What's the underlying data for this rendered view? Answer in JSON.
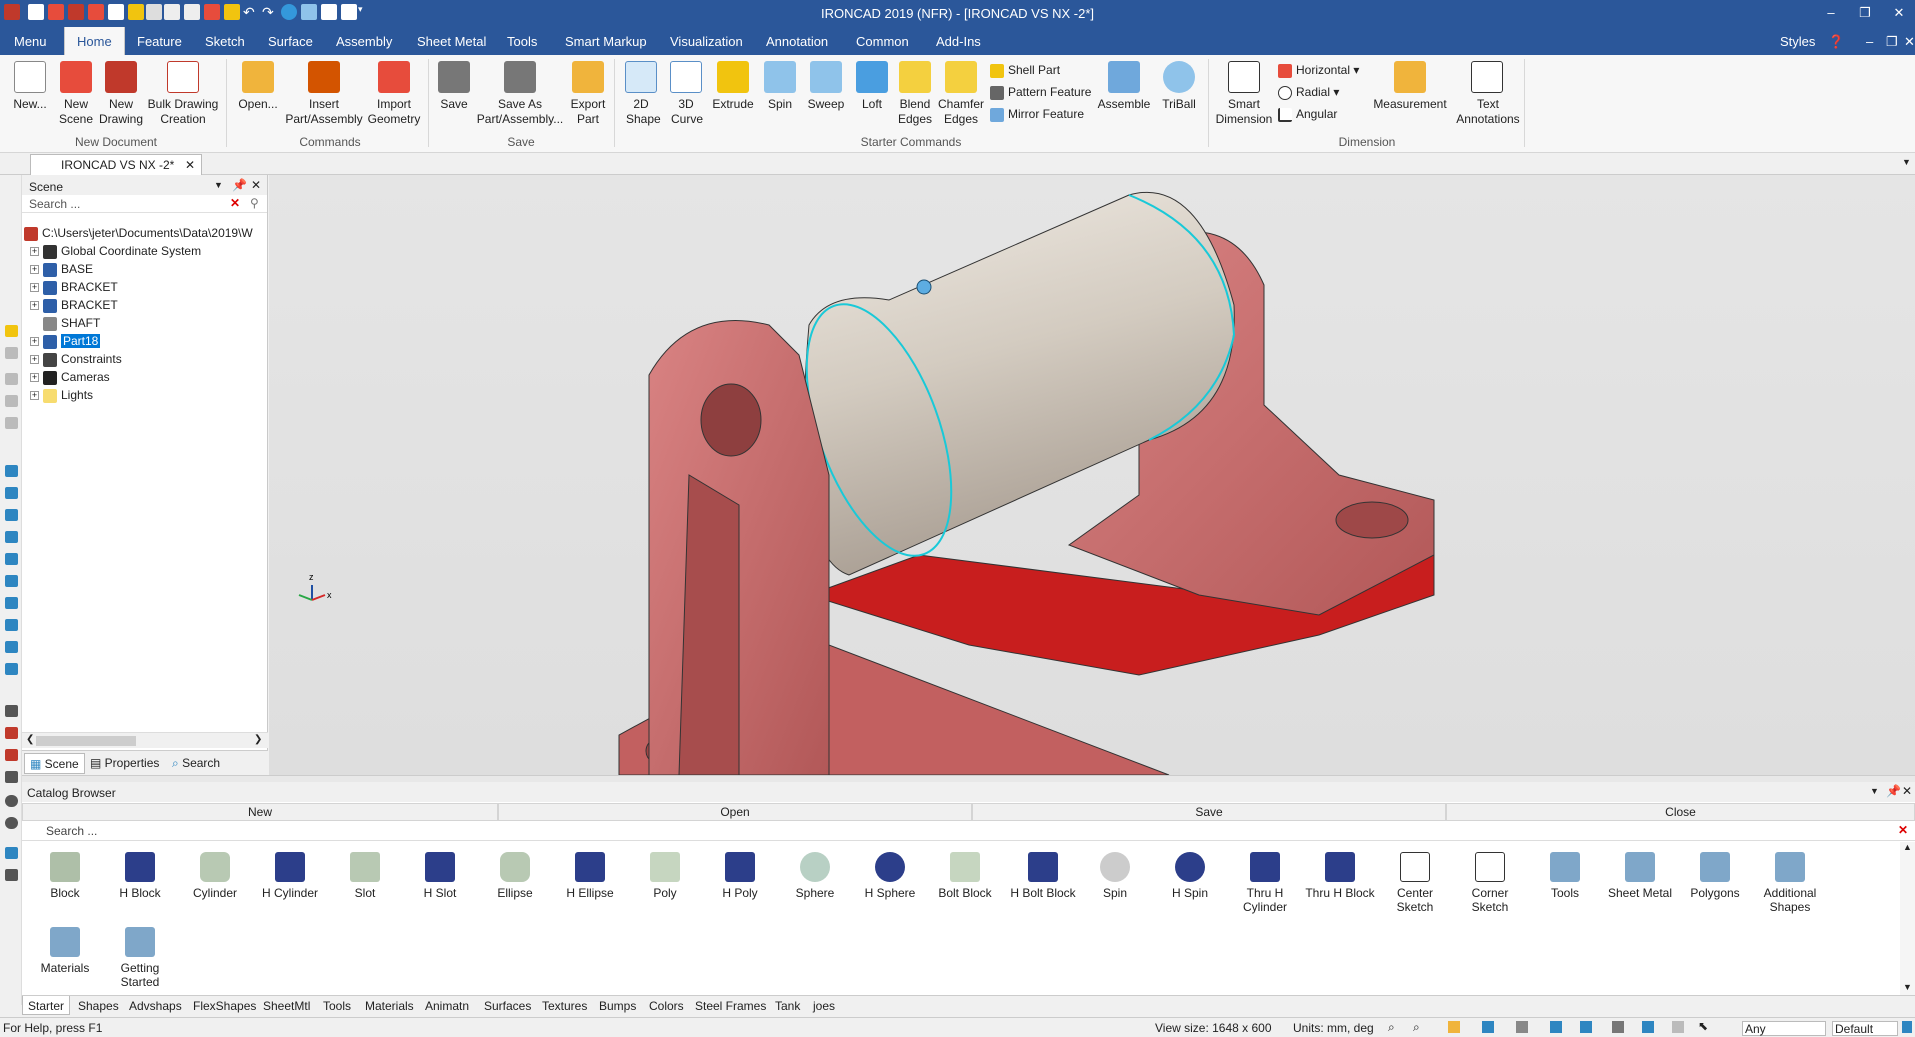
{
  "titlebar": {
    "title": "IRONCAD 2019 (NFR) - [IRONCAD VS NX -2*]"
  },
  "menu": {
    "tabs": [
      "Menu",
      "Home",
      "Feature",
      "Sketch",
      "Surface",
      "Assembly",
      "Sheet Metal",
      "Tools",
      "Smart Markup",
      "Visualization",
      "Annotation",
      "Common",
      "Add-Ins"
    ],
    "styles": "Styles"
  },
  "ribbon": {
    "buttons": [
      "New...",
      "New Scene",
      "New Drawing",
      "Bulk Drawing Creation",
      "Open...",
      "Insert Part/Assembly",
      "Import Geometry",
      "Save",
      "Save As Part/Assembly...",
      "Export Part",
      "2D Shape",
      "3D Curve",
      "Extrude",
      "Spin",
      "Sweep",
      "Loft",
      "Blend Edges",
      "Chamfer Edges",
      "Assemble",
      "TriBall",
      "Smart Dimension",
      "Measurement",
      "Text Annotations"
    ],
    "small": [
      "Shell Part",
      "Pattern Feature",
      "Mirror Feature",
      "Horizontal",
      "Radial",
      "Angular"
    ],
    "groups": [
      "New Document",
      "Commands",
      "Save",
      "Starter Commands",
      "Dimension"
    ]
  },
  "document": {
    "tab": "IRONCAD VS NX -2*"
  },
  "scene": {
    "title": "Scene",
    "search_placeholder": "Search ...",
    "tree": [
      "C:\\Users\\jeter\\Documents\\Data\\2019\\W",
      "Global Coordinate System",
      "BASE",
      "BRACKET",
      "BRACKET",
      "SHAFT",
      "Part18",
      "Constraints",
      "Cameras",
      "Lights"
    ],
    "bottom_tabs": [
      "Scene",
      "Properties",
      "Search"
    ]
  },
  "catalog": {
    "title": "Catalog Browser",
    "bars": [
      "New",
      "Open",
      "Save",
      "Close"
    ],
    "search_placeholder": "Search ...",
    "items": [
      "Block",
      "H Block",
      "Cylinder",
      "H Cylinder",
      "Slot",
      "H Slot",
      "Ellipse",
      "H Ellipse",
      "Poly",
      "H Poly",
      "Sphere",
      "H Sphere",
      "Bolt Block",
      "H Bolt Block",
      "Spin",
      "H Spin",
      "Thru H Cylinder",
      "Thru H Block",
      "Center Sketch",
      "Corner Sketch",
      "Tools",
      "Sheet Metal",
      "Polygons",
      "Additional Shapes",
      "Materials",
      "Getting Started"
    ],
    "tabs": [
      "Starter",
      "Shapes",
      "Advshaps",
      "FlexShapes",
      "SheetMtl",
      "Tools",
      "Materials",
      "Animatn",
      "Surfaces",
      "Textures",
      "Bumps",
      "Colors",
      "Steel Frames",
      "Tank",
      "joes"
    ]
  },
  "status": {
    "help": "For Help, press F1",
    "view_size": "View size: 1648 x 600",
    "units": "Units: mm, deg",
    "filter": "Any",
    "style": "Default"
  },
  "colors": {
    "accent": "#2b579a",
    "part": "#c66a6a",
    "shaft": "#d9d2c8",
    "base": "#c81e1e"
  }
}
